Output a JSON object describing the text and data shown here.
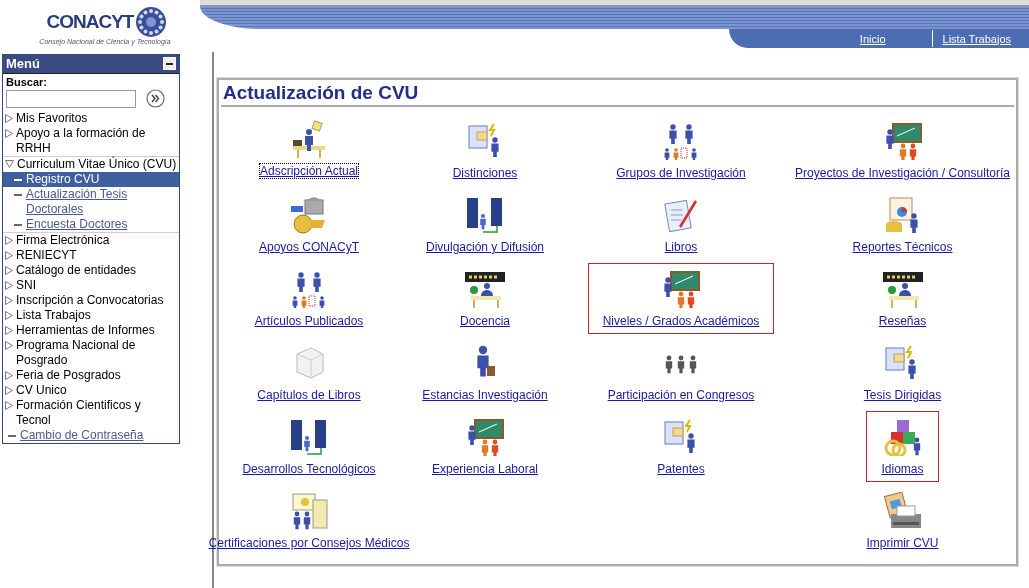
{
  "logo": {
    "name": "CONACYT",
    "subtitle": "Consejo Nacional de Ciencia y Tecnología"
  },
  "nav": [
    {
      "label": "Inicio"
    },
    {
      "label": "Lista Trabajos"
    }
  ],
  "menu": {
    "title": "Menú",
    "search": {
      "label": "Buscar:"
    },
    "items": [
      {
        "kind": "folder",
        "label": "Mis Favoritos",
        "expanded": false,
        "selected": false
      },
      {
        "kind": "folder",
        "label": "Apoyo a la formación de RRHH",
        "expanded": false,
        "selected": false
      },
      {
        "kind": "folder",
        "label": "Curriculum Vitae Único (CVU)",
        "expanded": true,
        "selected": false,
        "children": [
          {
            "kind": "link",
            "label": "Registro CVU",
            "selected": true
          },
          {
            "kind": "link",
            "label": "Actualización Tesis Doctorales",
            "selected": false
          },
          {
            "kind": "link",
            "label": "Encuesta Doctores",
            "selected": false
          }
        ]
      },
      {
        "kind": "folder",
        "label": "Firma Electrónica",
        "expanded": false,
        "selected": false
      },
      {
        "kind": "folder",
        "label": "RENIECYT",
        "expanded": false,
        "selected": false
      },
      {
        "kind": "folder",
        "label": "Catálogo de entidades",
        "expanded": false,
        "selected": false
      },
      {
        "kind": "folder",
        "label": "SNI",
        "expanded": false,
        "selected": false
      },
      {
        "kind": "folder",
        "label": "Inscripción a Convocatorias",
        "expanded": false,
        "selected": false
      },
      {
        "kind": "folder",
        "label": "Lista Trabajos",
        "expanded": false,
        "selected": false
      },
      {
        "kind": "folder",
        "label": "Herramientas de Informes",
        "expanded": false,
        "selected": false
      },
      {
        "kind": "folder",
        "label": "Programa Nacional de Posgrado",
        "expanded": false,
        "selected": false
      },
      {
        "kind": "folder",
        "label": "Feria de Posgrados",
        "expanded": false,
        "selected": false
      },
      {
        "kind": "folder",
        "label": "CV Unico",
        "expanded": false,
        "selected": false
      },
      {
        "kind": "folder",
        "label": "Formación Cientificos y Tecnol",
        "expanded": false,
        "selected": false
      },
      {
        "kind": "link",
        "label": "Cambio de Contraseña",
        "selected": false
      }
    ]
  },
  "panel": {
    "title": "Actualización de CVU",
    "rows": [
      [
        {
          "label": "Adscripción Actual",
          "highlighted": false,
          "focused": true
        },
        {
          "label": "Distinciones",
          "highlighted": false,
          "focused": false
        },
        {
          "label": "Grupos de Investigación",
          "highlighted": false,
          "focused": false
        },
        {
          "label": "Proyectos de Investigación / Consultoría",
          "highlighted": false,
          "focused": false
        }
      ],
      [
        {
          "label": "Apoyos CONACyT",
          "highlighted": false,
          "focused": false
        },
        {
          "label": "Divulgación y Difusión",
          "highlighted": false,
          "focused": false
        },
        {
          "label": "Libros",
          "highlighted": false,
          "focused": false
        },
        {
          "label": "Reportes Técnicos",
          "highlighted": false,
          "focused": false
        }
      ],
      [
        {
          "label": "Artículos Publicados",
          "highlighted": false,
          "focused": false
        },
        {
          "label": "Docencia",
          "highlighted": false,
          "focused": false
        },
        {
          "label": "Niveles / Grados Académicos",
          "highlighted": true,
          "focused": false
        },
        {
          "label": "Reseñas",
          "highlighted": false,
          "focused": false
        }
      ],
      [
        {
          "label": "Capítulos de Libros",
          "highlighted": false,
          "focused": false
        },
        {
          "label": "Estancias Investigación",
          "highlighted": false,
          "focused": false
        },
        {
          "label": "Participación en Congresos",
          "highlighted": false,
          "focused": false
        },
        {
          "label": "Tesis Dirigidas",
          "highlighted": false,
          "focused": false
        }
      ],
      [
        {
          "label": "Desarrollos Tecnológicos",
          "highlighted": false,
          "focused": false
        },
        {
          "label": "Experiencia Laboral",
          "highlighted": false,
          "focused": false
        },
        {
          "label": "Patentes",
          "highlighted": false,
          "focused": false
        },
        {
          "label": "Idiomas",
          "highlighted": true,
          "focused": false
        }
      ],
      [
        {
          "label": "Certificaciones por Consejos Médicos",
          "highlighted": false,
          "focused": false
        },
        null,
        null,
        {
          "label": "Imprimir CVU",
          "highlighted": false,
          "focused": false
        }
      ]
    ]
  }
}
